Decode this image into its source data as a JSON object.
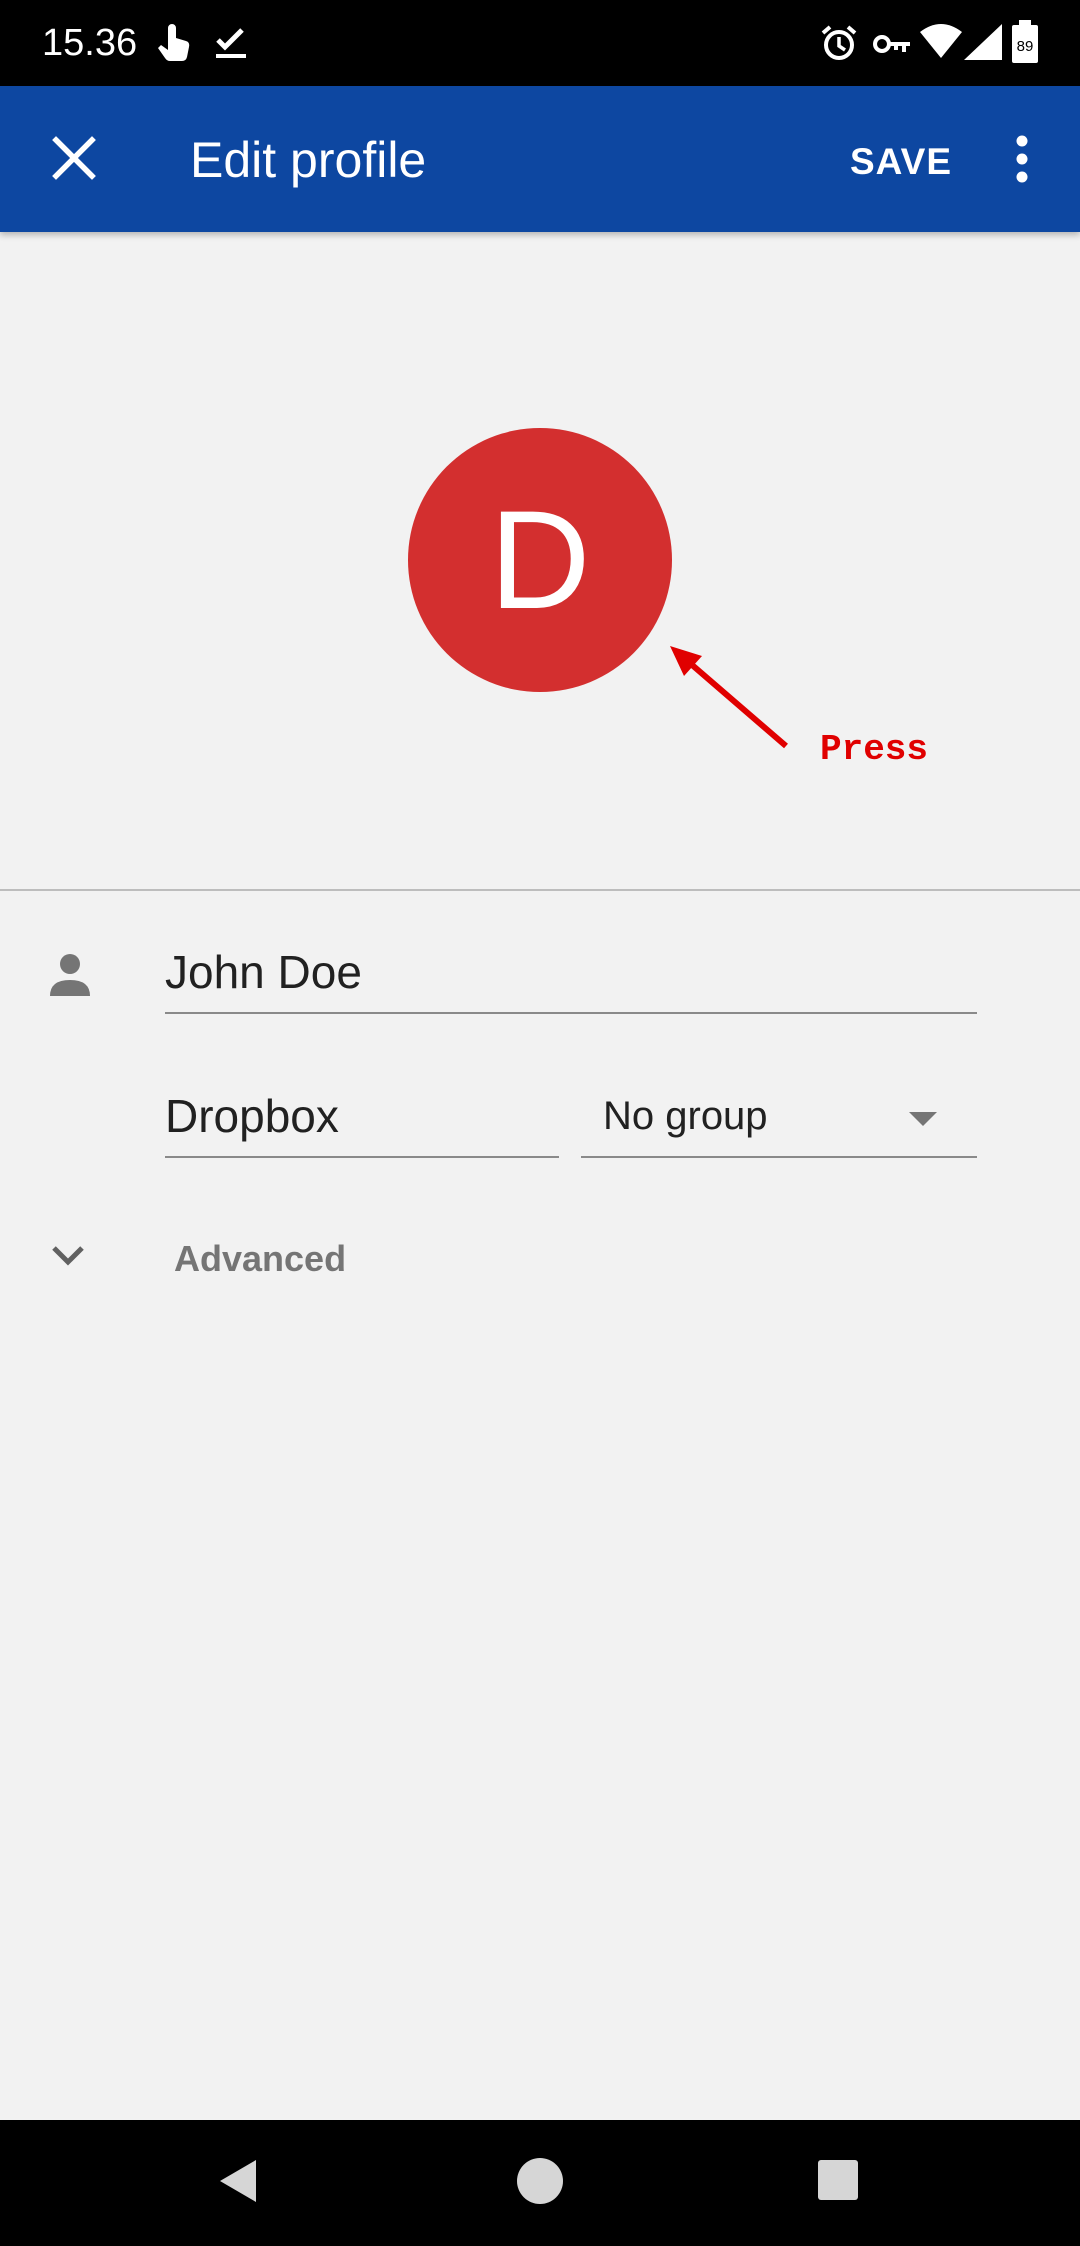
{
  "status_bar": {
    "time": "15.36",
    "battery_level": "89",
    "icons": [
      "touch-icon",
      "download-done-icon",
      "alarm-icon",
      "vpn-key-icon",
      "wifi-icon",
      "signal-icon",
      "battery-icon"
    ]
  },
  "app_bar": {
    "title": "Edit profile",
    "save_label": "SAVE",
    "close_icon": "close-icon",
    "more_icon": "more-vert-icon",
    "color": "#0d47a1"
  },
  "avatar": {
    "initial": "D",
    "color": "#d32f2f"
  },
  "annotation": {
    "label": "Press",
    "color": "#e00000"
  },
  "form": {
    "name_value": "John Doe",
    "account_value": "Dropbox",
    "group_value": "No group",
    "advanced_label": "Advanced"
  },
  "nav_bar": {
    "buttons": [
      "back-icon",
      "home-icon",
      "recents-icon"
    ]
  }
}
